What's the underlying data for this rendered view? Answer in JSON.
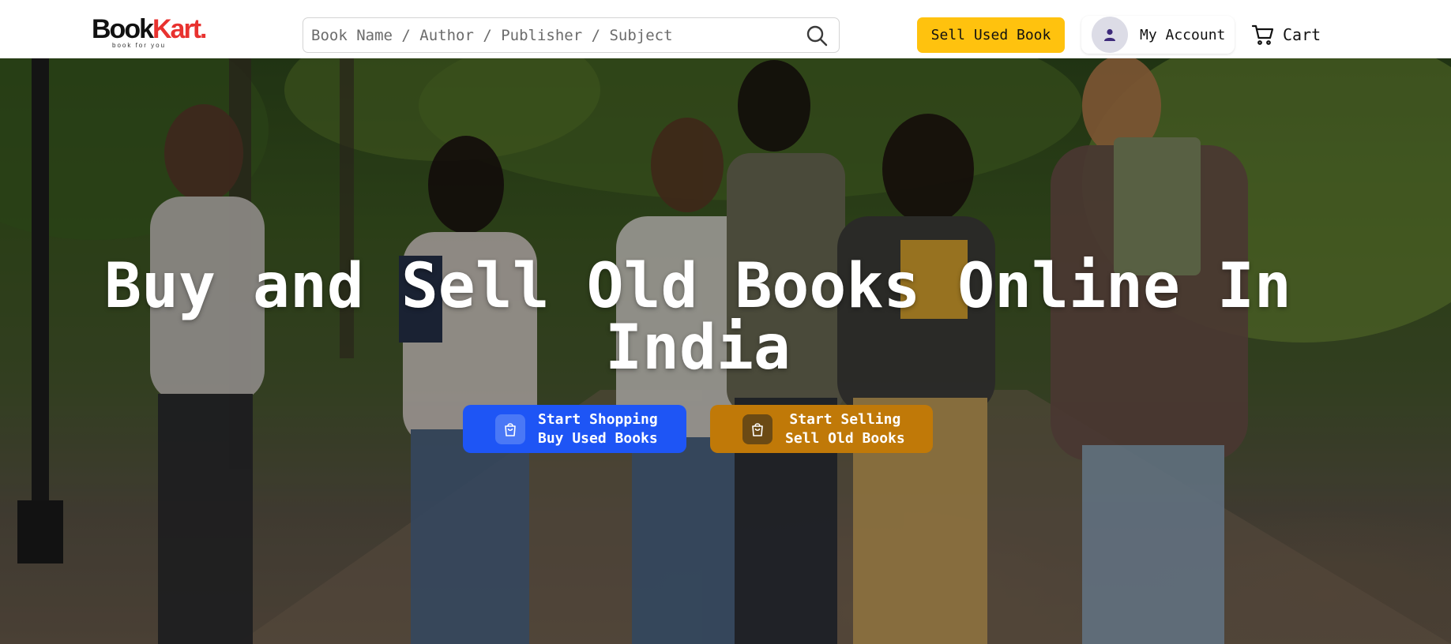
{
  "brand": {
    "name_part1": "Book",
    "name_part2": "Kart.",
    "tagline": "book for you",
    "accent_color": "#e8322f"
  },
  "search": {
    "placeholder": "Book Name / Author / Publisher / Subject",
    "value": "",
    "icon": "search-icon"
  },
  "nav": {
    "sell_label": "Sell Used Book",
    "sell_color": "#ffc20e",
    "account_label": "My Account",
    "account_icon": "user-icon",
    "cart_label": "Cart",
    "cart_icon": "cart-icon"
  },
  "hero": {
    "title_line1": "Buy and Sell Old Books Online In",
    "title_line2": "India",
    "shop_button": {
      "line1": "Start Shopping",
      "line2": "Buy Used Books",
      "icon": "shopping-bag-icon",
      "color": "#1e55f5"
    },
    "sell_button": {
      "line1": "Start Selling",
      "line2": "Sell Old Books",
      "icon": "shopping-bag-icon",
      "color": "#c07908"
    }
  }
}
